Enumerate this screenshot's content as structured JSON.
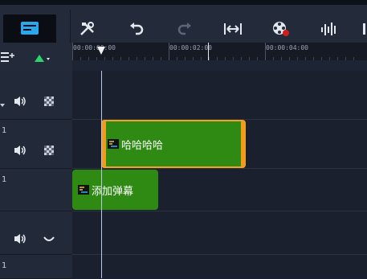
{
  "toolbar": {
    "buttons": [
      {
        "name": "timeline-view-button",
        "icon": "timeline-view-icon",
        "active": true
      },
      {
        "name": "tools-button",
        "icon": "tools-icon"
      },
      {
        "name": "undo-button",
        "icon": "undo-icon"
      },
      {
        "name": "redo-button",
        "icon": "redo-icon"
      },
      {
        "name": "fit-project-button",
        "icon": "fit-width-icon"
      },
      {
        "name": "record-capture-button",
        "icon": "record-icon"
      },
      {
        "name": "audio-mixer-button",
        "icon": "audio-wave-icon"
      }
    ]
  },
  "controls": {
    "add_track_icon": "track-manager-icon",
    "marker_icon": "add-marker-icon"
  },
  "ruler": {
    "labels": [
      "00:00:00:00",
      "00:00:02:00",
      "00:00:04:00"
    ]
  },
  "tracks": [
    {
      "number": "",
      "icons": [
        "volume-icon",
        "checker-icon"
      ]
    },
    {
      "number": "1",
      "icons": [
        "volume-icon",
        "checker-icon"
      ]
    },
    {
      "number": "1",
      "icons": []
    },
    {
      "number": "",
      "icons": [
        "volume-icon",
        "waveform-icon"
      ]
    },
    {
      "number": "1",
      "icons": []
    }
  ],
  "clips": [
    {
      "label": "哈哈哈哈",
      "selected": true
    },
    {
      "label": "添加弹幕",
      "selected": false
    }
  ],
  "colors": {
    "clip": "#2e8a13",
    "selection": "#f1a321",
    "accent": "#29a8f0"
  }
}
